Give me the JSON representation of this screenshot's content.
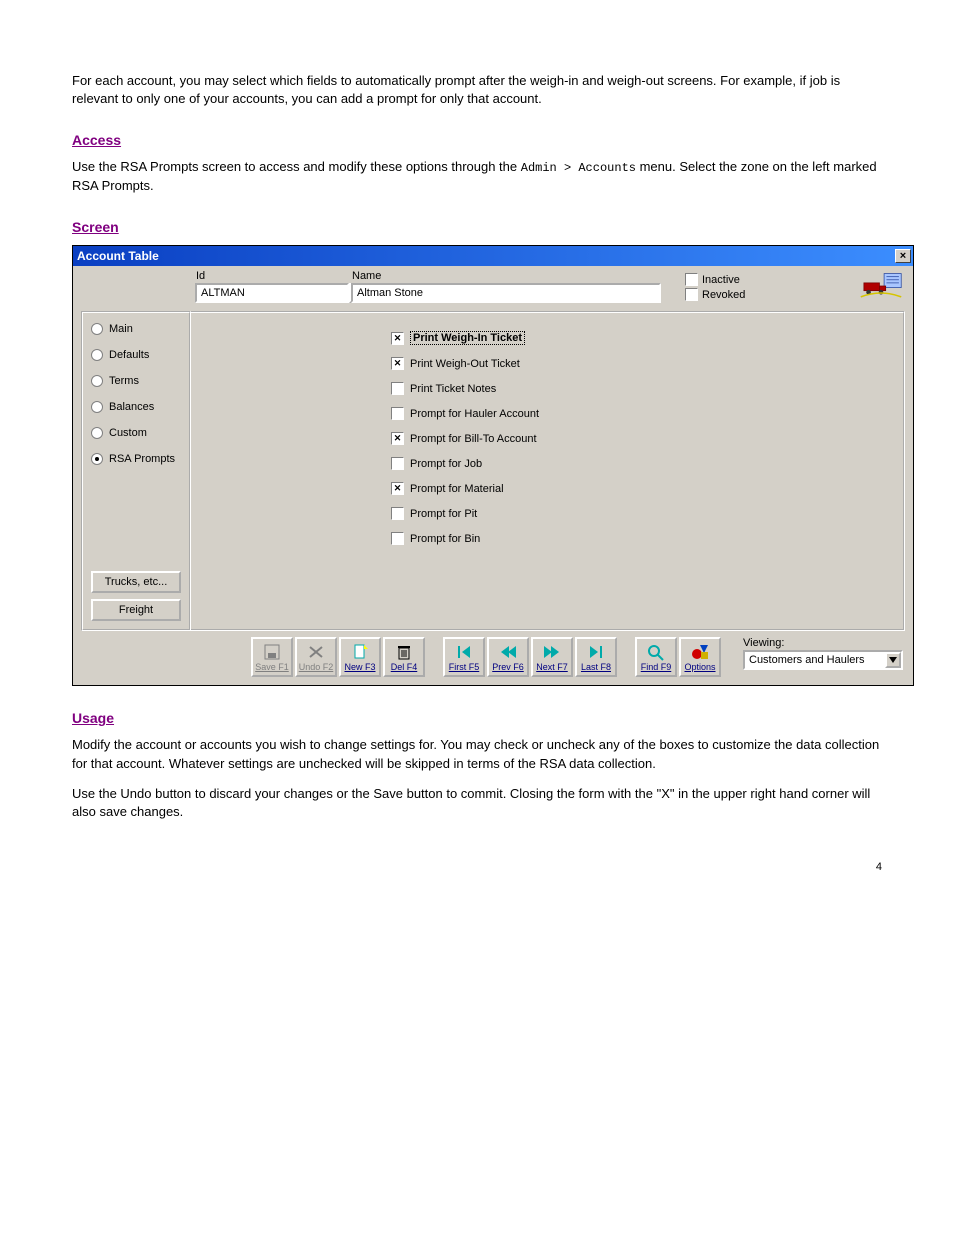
{
  "doc": {
    "p1": "For each account, you may select which fields to automatically prompt after the weigh-in and weigh-out screens. For example, if job is relevant to only one of your accounts, you can add a prompt for only that account.",
    "h1": "Access",
    "p2_prefix": "Use the RSA Prompts screen to access and modify these options through the ",
    "p2_menu": "Admin > Accounts",
    "p2_suffix": " menu. Select the zone on the left marked RSA Prompts.",
    "h2": "Screen",
    "h3": "Usage",
    "p3": "Modify the account or accounts you wish to change settings for. You may check or uncheck any of the boxes to customize the data collection for that account. Whatever settings are unchecked will be skipped in terms of the RSA data collection.",
    "p4": "Use the Undo button to discard your changes or the Save button to commit. Closing the form with the \"X\" in the upper right hand corner will also save changes.",
    "page_number": "4"
  },
  "win": {
    "title": "Account Table",
    "id_label": "Id",
    "id_value": "ALTMAN",
    "name_label": "Name",
    "name_value": "Altman Stone",
    "inactive_label": "Inactive",
    "revoked_label": "Revoked",
    "sidebar": {
      "items": [
        {
          "label": "Main",
          "selected": false
        },
        {
          "label": "Defaults",
          "selected": false
        },
        {
          "label": "Terms",
          "selected": false
        },
        {
          "label": "Balances",
          "selected": false
        },
        {
          "label": "Custom",
          "selected": false
        },
        {
          "label": "RSA Prompts",
          "selected": true
        }
      ],
      "trucks_btn": "Trucks, etc...",
      "freight_btn": "Freight"
    },
    "prompts": [
      {
        "label": "Print Weigh-In Ticket",
        "checked": true,
        "focused": true
      },
      {
        "label": "Print Weigh-Out Ticket",
        "checked": true
      },
      {
        "label": "Print Ticket Notes",
        "checked": false
      },
      {
        "label": "Prompt for Hauler Account",
        "checked": false
      },
      {
        "label": "Prompt for Bill-To Account",
        "checked": true
      },
      {
        "label": "Prompt for Job",
        "checked": false
      },
      {
        "label": "Prompt for Material",
        "checked": true
      },
      {
        "label": "Prompt for Pit",
        "checked": false
      },
      {
        "label": "Prompt for Bin",
        "checked": false
      }
    ],
    "toolbar": {
      "save": "Save F1",
      "undo": "Undo F2",
      "new": "New F3",
      "del": "Del F4",
      "first": "First F5",
      "prev": "Prev F6",
      "next": "Next F7",
      "last": "Last F8",
      "find": "Find F9",
      "options": "Options"
    },
    "viewing_label": "Viewing:",
    "viewing_value": "Customers and Haulers"
  }
}
